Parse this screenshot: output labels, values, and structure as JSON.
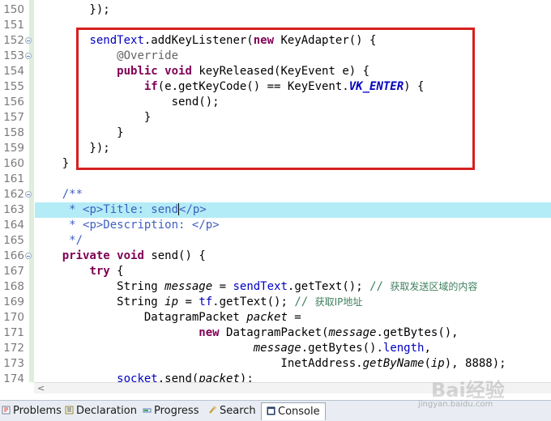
{
  "colors": {
    "keyword": "#7f0055",
    "field": "#0000c0",
    "javadoc": "#3f5fbf",
    "annotation": "#646464",
    "comment": "#3f7f5f",
    "highlight": "#b3ecf6",
    "annotation_box": "#d62020"
  },
  "editor": {
    "lines": [
      {
        "num": "150",
        "fold": false,
        "hl": false,
        "tokens": [
          {
            "t": "        });"
          }
        ]
      },
      {
        "num": "151",
        "fold": false,
        "hl": false,
        "tokens": []
      },
      {
        "num": "152",
        "fold": true,
        "hl": false,
        "tokens": [
          {
            "t": "        "
          },
          {
            "t": "sendText",
            "c": "f"
          },
          {
            "t": ".addKeyListener("
          },
          {
            "t": "new",
            "c": "k"
          },
          {
            "t": " KeyAdapter() {"
          }
        ]
      },
      {
        "num": "153",
        "fold": true,
        "hl": false,
        "tokens": [
          {
            "t": "            "
          },
          {
            "t": "@Override",
            "c": "a"
          }
        ]
      },
      {
        "num": "154",
        "fold": false,
        "hl": false,
        "tokens": [
          {
            "t": "            "
          },
          {
            "t": "public",
            "c": "k"
          },
          {
            "t": " "
          },
          {
            "t": "void",
            "c": "k"
          },
          {
            "t": " keyReleased(KeyEvent e) {"
          }
        ]
      },
      {
        "num": "155",
        "fold": false,
        "hl": false,
        "tokens": [
          {
            "t": "                "
          },
          {
            "t": "if",
            "c": "k"
          },
          {
            "t": "(e.getKeyCode() == KeyEvent."
          },
          {
            "t": "VK_ENTER",
            "c": "st"
          },
          {
            "t": ") {"
          }
        ]
      },
      {
        "num": "156",
        "fold": false,
        "hl": false,
        "tokens": [
          {
            "t": "                    send();"
          }
        ]
      },
      {
        "num": "157",
        "fold": false,
        "hl": false,
        "tokens": [
          {
            "t": "                }"
          }
        ]
      },
      {
        "num": "158",
        "fold": false,
        "hl": false,
        "tokens": [
          {
            "t": "            }"
          }
        ]
      },
      {
        "num": "159",
        "fold": false,
        "hl": false,
        "tokens": [
          {
            "t": "        });"
          }
        ]
      },
      {
        "num": "160",
        "fold": false,
        "hl": false,
        "tokens": [
          {
            "t": "    }"
          }
        ]
      },
      {
        "num": "161",
        "fold": false,
        "hl": false,
        "tokens": []
      },
      {
        "num": "162",
        "fold": true,
        "hl": false,
        "tokens": [
          {
            "t": "    "
          },
          {
            "t": "/**",
            "c": "c"
          }
        ]
      },
      {
        "num": "163",
        "fold": false,
        "hl": true,
        "tokens": [
          {
            "t": "     "
          },
          {
            "t": "* <p>Title: send",
            "c": "c"
          },
          {
            "caret": true
          },
          {
            "t": "</p>",
            "c": "c"
          }
        ]
      },
      {
        "num": "164",
        "fold": false,
        "hl": false,
        "tokens": [
          {
            "t": "     "
          },
          {
            "t": "* <p>Description: </p>",
            "c": "c"
          }
        ]
      },
      {
        "num": "165",
        "fold": false,
        "hl": false,
        "tokens": [
          {
            "t": "     "
          },
          {
            "t": "*/",
            "c": "c"
          }
        ]
      },
      {
        "num": "166",
        "fold": true,
        "hl": false,
        "tokens": [
          {
            "t": "    "
          },
          {
            "t": "private",
            "c": "k"
          },
          {
            "t": " "
          },
          {
            "t": "void",
            "c": "k"
          },
          {
            "t": " send() {"
          }
        ]
      },
      {
        "num": "167",
        "fold": false,
        "hl": false,
        "tokens": [
          {
            "t": "        "
          },
          {
            "t": "try",
            "c": "k"
          },
          {
            "t": " {"
          }
        ]
      },
      {
        "num": "168",
        "fold": false,
        "hl": false,
        "tokens": [
          {
            "t": "            String "
          },
          {
            "t": "message",
            "c": "m"
          },
          {
            "t": " = "
          },
          {
            "t": "sendText",
            "c": "f"
          },
          {
            "t": ".getText(); "
          },
          {
            "t": "// ",
            "c": "cm"
          },
          {
            "t": "获取发送区域的内容",
            "c": "cn"
          }
        ]
      },
      {
        "num": "169",
        "fold": false,
        "hl": false,
        "tokens": [
          {
            "t": "            String "
          },
          {
            "t": "ip",
            "c": "m"
          },
          {
            "t": " = "
          },
          {
            "t": "tf",
            "c": "f"
          },
          {
            "t": ".getText(); "
          },
          {
            "t": "// ",
            "c": "cm"
          },
          {
            "t": "获取IP地址",
            "c": "cn"
          }
        ]
      },
      {
        "num": "170",
        "fold": false,
        "hl": false,
        "tokens": [
          {
            "t": "                DatagramPacket "
          },
          {
            "t": "packet",
            "c": "m"
          },
          {
            "t": " ="
          }
        ]
      },
      {
        "num": "171",
        "fold": false,
        "hl": false,
        "tokens": [
          {
            "t": "                        "
          },
          {
            "t": "new",
            "c": "k"
          },
          {
            "t": " DatagramPacket("
          },
          {
            "t": "message",
            "c": "m"
          },
          {
            "t": ".getBytes(),"
          }
        ]
      },
      {
        "num": "172",
        "fold": false,
        "hl": false,
        "tokens": [
          {
            "t": "                                "
          },
          {
            "t": "message",
            "c": "m"
          },
          {
            "t": ".getBytes()."
          },
          {
            "t": "length",
            "c": "f"
          },
          {
            "t": ","
          }
        ]
      },
      {
        "num": "173",
        "fold": false,
        "hl": false,
        "tokens": [
          {
            "t": "                                    InetAddress."
          },
          {
            "t": "getByName",
            "c": "m"
          },
          {
            "t": "("
          },
          {
            "t": "ip",
            "c": "m"
          },
          {
            "t": "), 8888);"
          }
        ]
      },
      {
        "num": "174",
        "fold": false,
        "hl": false,
        "tokens": [
          {
            "t": "            "
          },
          {
            "t": "socket",
            "c": "f"
          },
          {
            "t": ".send("
          },
          {
            "t": "packet",
            "c": "m"
          },
          {
            "t": ");"
          }
        ]
      }
    ]
  },
  "scrollbar": {
    "left_arrow": "<"
  },
  "tabs": [
    {
      "label": "Problems",
      "icon": "problems-icon",
      "active": false
    },
    {
      "label": "Declaration",
      "icon": "declaration-icon",
      "active": false
    },
    {
      "label": "Progress",
      "icon": "progress-icon",
      "active": false
    },
    {
      "label": "Search",
      "icon": "search-icon",
      "active": false
    },
    {
      "label": "Console",
      "icon": "console-icon",
      "active": true
    }
  ],
  "watermark": {
    "text": "Bai经验",
    "url": "jingyan.baidu.com"
  }
}
